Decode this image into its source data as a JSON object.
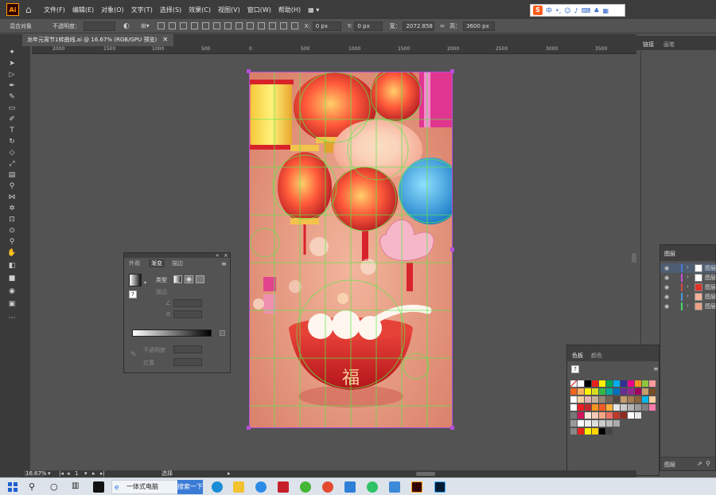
{
  "app": {
    "logo_text": "Ai",
    "menus": [
      "文件(F)",
      "编辑(E)",
      "对象(O)",
      "文字(T)",
      "选择(S)",
      "效果(C)",
      "视图(V)",
      "窗口(W)",
      "帮助(H)"
    ],
    "workspace_icon": "grid-icon"
  },
  "ime": {
    "label": "中"
  },
  "control_bar": {
    "selection_label": "混合对象",
    "opacity_label": "不透明度：",
    "x_label": "X:",
    "x_value": "0 px",
    "y_label": "Y:",
    "y_value": "0 px",
    "width_label": "宽：",
    "width_value": "2072.858",
    "height_label": "高：",
    "height_value": "3600 px"
  },
  "document": {
    "tab_title": "龙年元宵节1转曲线.ai @ 16.67% (RGB/GPU 预览)",
    "close": "×"
  },
  "ruler": {
    "labels": [
      "2000",
      "1500",
      "1000",
      "500",
      "0",
      "500",
      "1000",
      "1500",
      "2000",
      "2500",
      "3000",
      "3500"
    ]
  },
  "artwork": {
    "bowl_character": "福",
    "colors": {
      "background": "#e9a285",
      "bowl": "#d9322f",
      "lantern_red": "#e0322b",
      "lantern_pink": "#ffb7c0",
      "yellow": "#f6e04a",
      "blue": "#1f8fd8",
      "guide_green": "#5ee84b",
      "selection_purple": "#b44fd8"
    }
  },
  "status_bar": {
    "zoom": "16.67%",
    "page": "1",
    "mode": "选择"
  },
  "panels": {
    "gradient": {
      "tabs": [
        "外观",
        "渐变",
        "描边"
      ],
      "active_tab": "渐变",
      "type_label": "类型",
      "stroke_label": "描边",
      "opacity_label": "不透明度",
      "location_label": "位置"
    },
    "right_tabs": [
      "链接",
      "画笔"
    ],
    "layers": {
      "title": "图层",
      "items": [
        {
          "name": "图层",
          "color": "#4d78d8"
        },
        {
          "name": "图层",
          "color": "#c44fd8"
        },
        {
          "name": "图层",
          "color": "#d94a4a"
        },
        {
          "name": "图层",
          "color": "#4a9bd9"
        },
        {
          "name": "图层",
          "color": "#4ad96a"
        }
      ],
      "footer_label": "图层"
    },
    "swatches": {
      "tabs": [
        "色板",
        "颜色"
      ]
    }
  },
  "taskbar": {
    "browser_label": "一体式电脑",
    "search_button": "搜索一下"
  }
}
